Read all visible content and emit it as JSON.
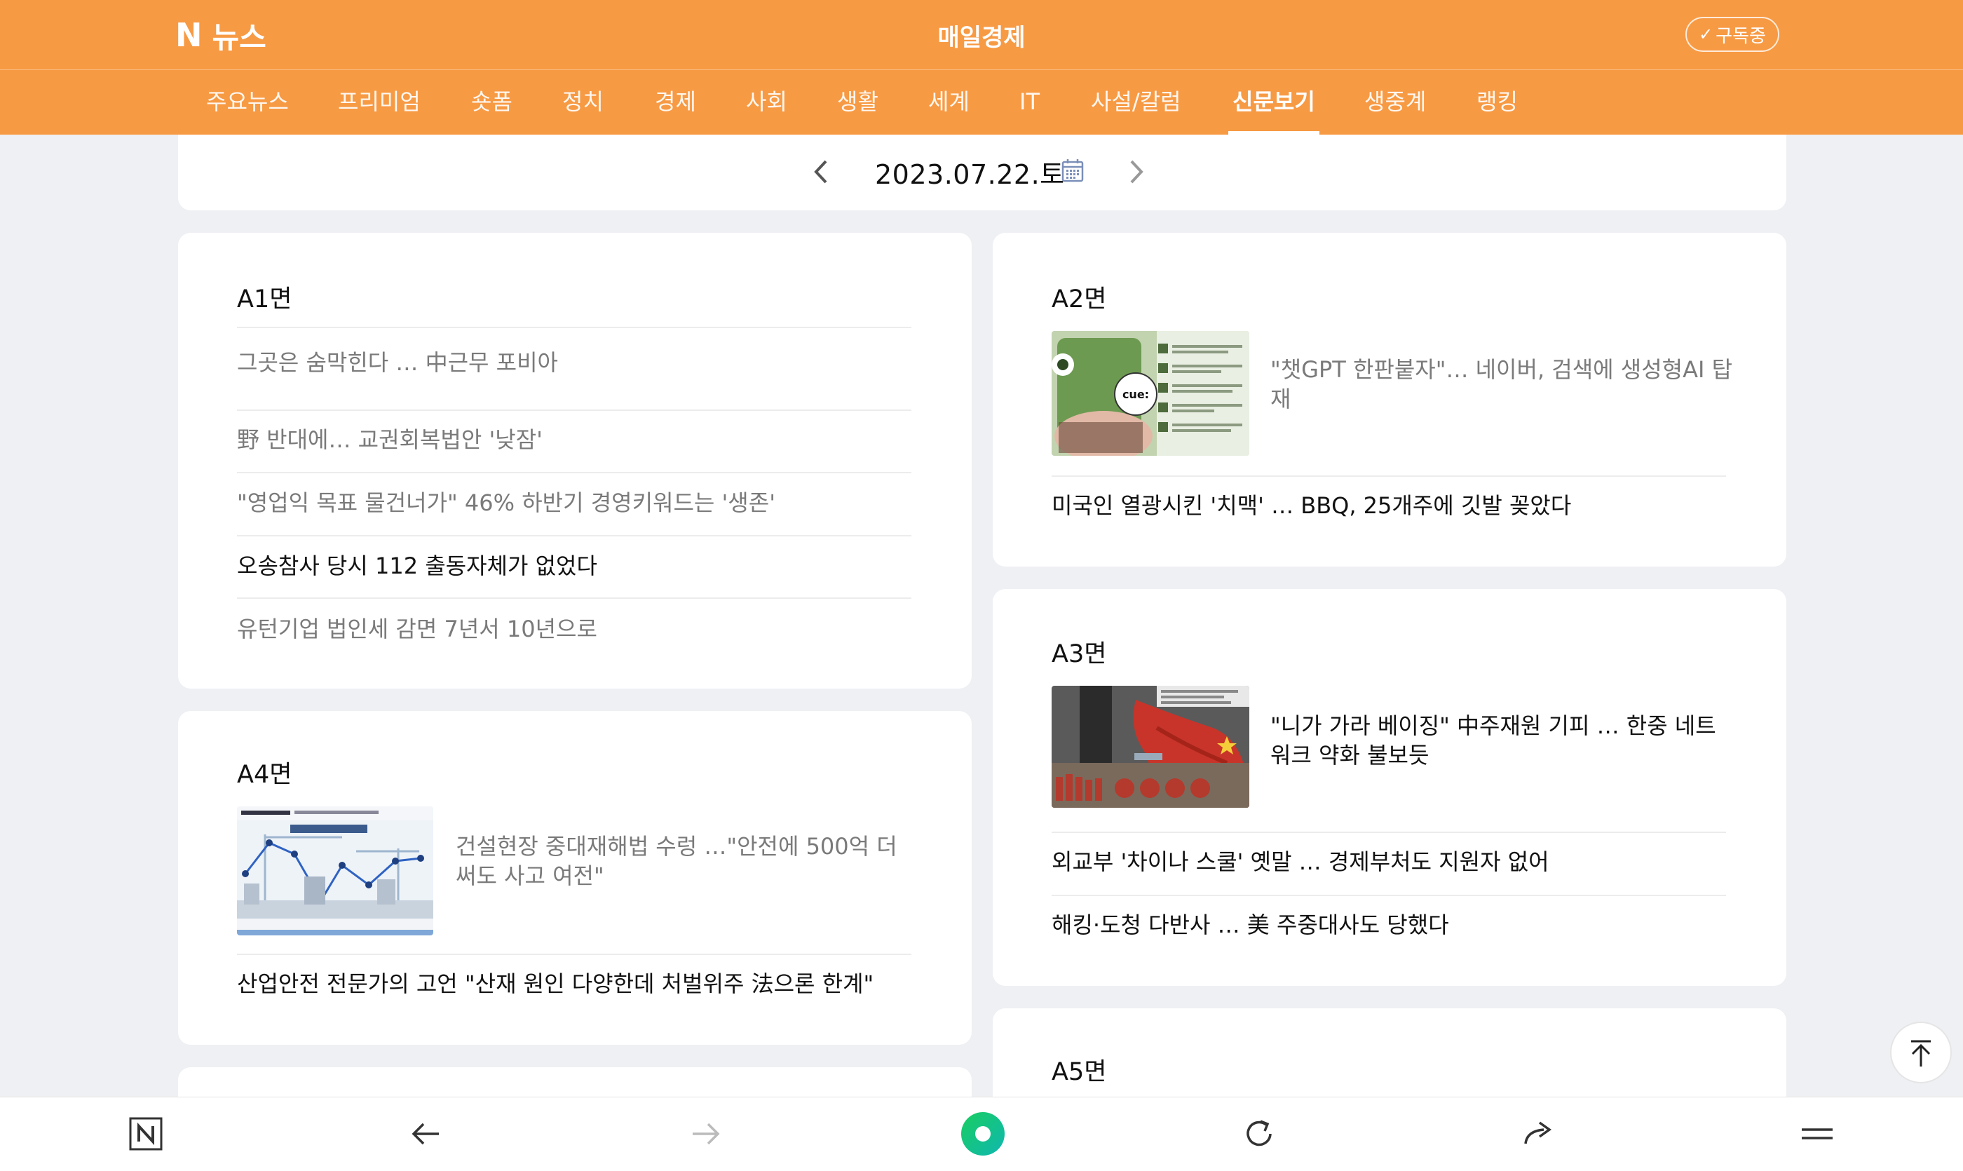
{
  "header": {
    "logo_mark": "N",
    "logo_text": "뉴스",
    "press_name": "매일경제",
    "subscribe_label": "구독중"
  },
  "nav": {
    "items": [
      "주요뉴스",
      "프리미엄",
      "숏폼",
      "정치",
      "경제",
      "사회",
      "생활",
      "세계",
      "IT",
      "사설/칼럼",
      "신문보기",
      "생중계",
      "랭킹"
    ],
    "active": "신문보기"
  },
  "datebar": {
    "date": "2023.07.22.토"
  },
  "pages": {
    "a1": {
      "title": "A1면",
      "headlines": [
        "그곳은 숨막힌다 … 中근무 포비아",
        "野 반대에… 교권회복법안 '낮잠'",
        "\"영업익 목표 물건너가\" 46% 하반기 경영키워드는 '생존'",
        "오송참사 당시 112 출동자체가 없었다",
        "유턴기업 법인세 감면 7년서 10년으로"
      ]
    },
    "a2": {
      "title": "A2면",
      "thumb_headline": "\"챗GPT 한판붙자\"… 네이버, 검색에 생성형AI 탑재",
      "thumb_caption": "cue:",
      "headlines": [
        "미국인 열광시킨 '치맥' … BBQ, 25개주에 깃발 꽂았다"
      ]
    },
    "a3": {
      "title": "A3면",
      "thumb_headline": "\"니가 가라 베이징\" 中주재원 기피 … 한중 네트워크 약화 불보듯",
      "headlines": [
        "외교부 '차이나 스쿨' 옛말 … 경제부처도 지원자 없어",
        "해킹·도청 다반사 … 美 주중대사도 당했다"
      ]
    },
    "a4": {
      "title": "A4면",
      "thumb_headline": "건설현장 중대재해법 수렁 …\"안전에 500억 더 써도 사고 여전\"",
      "headlines": [
        "산업안전 전문가의 고언 \"산재 원인 다양한데 처벌위주 法으론 한계\""
      ]
    },
    "a5": {
      "title": "A5면"
    }
  },
  "bottombar": {
    "icons": [
      "naver-home-icon",
      "back-arrow-icon",
      "forward-arrow-icon",
      "green-dot-icon",
      "refresh-icon",
      "share-icon",
      "menu-icon"
    ]
  },
  "colors": {
    "brand_orange": "#f79a44",
    "background": "#eef0f3",
    "naver_green": "#19ce60"
  }
}
